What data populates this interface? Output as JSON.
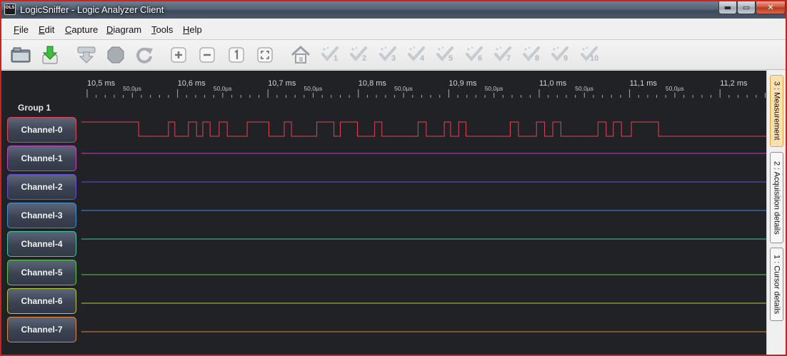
{
  "window": {
    "title": "LogicSniffer - Logic Analyzer Client",
    "icon_text": "OLS",
    "min_glyph": "▬",
    "max_glyph": "▭",
    "close_glyph": "✕"
  },
  "menu": [
    {
      "label": "File",
      "mnemonic": "F",
      "rest": "ile"
    },
    {
      "label": "Edit",
      "mnemonic": "E",
      "rest": "dit"
    },
    {
      "label": "Capture",
      "mnemonic": "C",
      "rest": "apture"
    },
    {
      "label": "Diagram",
      "mnemonic": "D",
      "rest": "iagram"
    },
    {
      "label": "Tools",
      "mnemonic": "T",
      "rest": "ools"
    },
    {
      "label": "Help",
      "mnemonic": "H",
      "rest": "elp"
    }
  ],
  "toolbar": {
    "icons": [
      "open-icon",
      "save-icon",
      "capture-icon",
      "stop-icon",
      "repeat-capture-icon",
      "zoom-in-icon",
      "zoom-out-icon",
      "zoom-original-icon",
      "zoom-all-icon",
      "goto-trigger-icon"
    ],
    "cursor_buttons": [
      "1",
      "2",
      "3",
      "4",
      "5",
      "6",
      "7",
      "8",
      "9",
      "10"
    ]
  },
  "timeline": {
    "major_labels": [
      "10,5 ms",
      "10,6 ms",
      "10,7 ms",
      "10,8 ms",
      "10,9 ms",
      "11,0 ms",
      "11,1 ms",
      "11,2 ms"
    ],
    "minor_label": "50,0µs"
  },
  "group": {
    "label": "Group 1"
  },
  "channels": [
    {
      "label": "Channel-0",
      "color": "#e2445a"
    },
    {
      "label": "Channel-1",
      "color": "#c93fc0"
    },
    {
      "label": "Channel-2",
      "color": "#6a4fd9"
    },
    {
      "label": "Channel-3",
      "color": "#3f8fd9"
    },
    {
      "label": "Channel-4",
      "color": "#41c6a4"
    },
    {
      "label": "Channel-5",
      "color": "#5dc94a"
    },
    {
      "label": "Channel-6",
      "color": "#b9c93e"
    },
    {
      "label": "Channel-7",
      "color": "#e0873d"
    }
  ],
  "channel0_signal": {
    "initial_level": "high",
    "edge_times_ms": [
      10.557,
      10.59,
      10.597,
      10.612,
      10.621,
      10.628,
      10.636,
      10.646,
      10.655,
      10.677,
      10.701,
      10.718,
      10.726,
      10.754,
      10.773,
      10.78,
      10.799,
      10.818,
      10.826,
      10.866,
      10.875,
      10.895,
      10.902,
      10.911,
      10.919,
      10.968,
      10.977,
      10.997,
      11.006,
      11.015,
      11.024,
      11.065,
      11.074,
      11.082,
      11.091,
      11.102,
      11.132
    ]
  },
  "dock_tabs": [
    "3 : Measurement",
    "2 : Acquisition details",
    "1 : Cursor details"
  ]
}
